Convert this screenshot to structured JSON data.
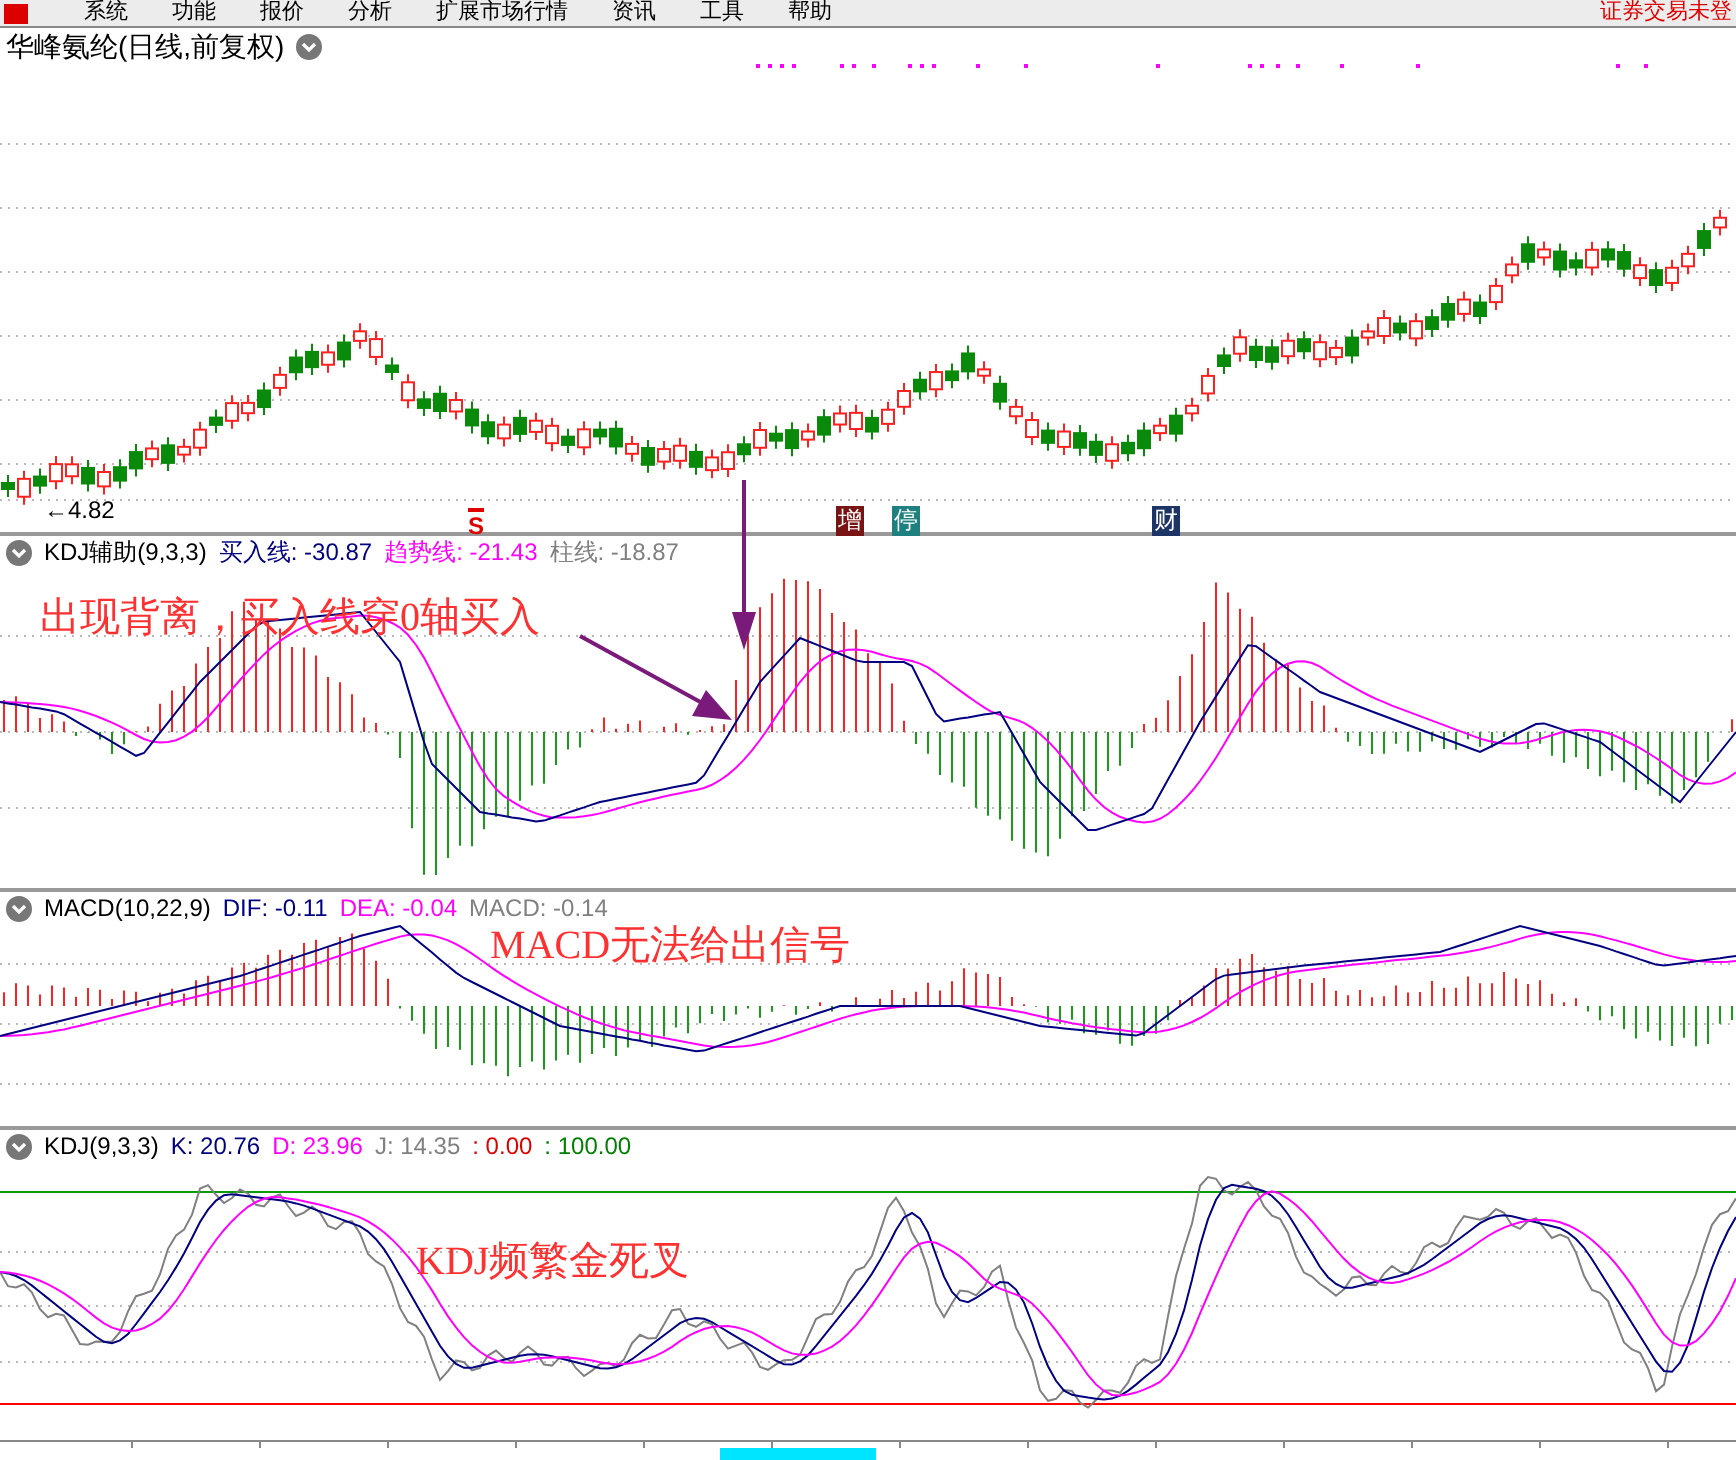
{
  "menu": [
    "系统",
    "功能",
    "报价",
    "分析",
    "扩展市场行情",
    "资讯",
    "工具",
    "帮助"
  ],
  "login_status": "证券交易未登",
  "title": "华峰氨纶(日线,前复权)",
  "price_panel": {
    "low_label": "←4.82",
    "markers": [
      {
        "text": "S",
        "kind": "signal",
        "color": "#e00000"
      },
      {
        "text": "增",
        "kind": "badge",
        "color": "#7a1414"
      },
      {
        "text": "停",
        "kind": "badge",
        "color": "#1f8080"
      },
      {
        "text": "财",
        "kind": "badge",
        "color": "#1c3566"
      }
    ]
  },
  "panels": [
    {
      "name": "KDJ辅助(9,3,3)",
      "values": [
        {
          "text": "买入线: -30.87",
          "color": "#000080"
        },
        {
          "text": "趋势线: -21.43",
          "color": "#ff00ff"
        },
        {
          "text": "柱线: -18.87",
          "color": "#808080"
        }
      ],
      "annotation": "出现背离，买入线穿0轴买入"
    },
    {
      "name": "MACD(10,22,9)",
      "values": [
        {
          "text": "DIF: -0.11",
          "color": "#000080"
        },
        {
          "text": "DEA: -0.04",
          "color": "#ff00ff"
        },
        {
          "text": "MACD: -0.14",
          "color": "#808080"
        }
      ],
      "annotation": "MACD无法给出信号"
    },
    {
      "name": "KDJ(9,3,3)",
      "values": [
        {
          "text": "K: 20.76",
          "color": "#000080"
        },
        {
          "text": "D: 23.96",
          "color": "#ff00ff"
        },
        {
          "text": "J: 14.35",
          "color": "#808080"
        },
        {
          "text": ": 0.00",
          "color": "#e00000"
        },
        {
          "text": ": 100.00",
          "color": "#008000"
        }
      ],
      "annotation": "KDJ频繁金死叉"
    }
  ]
}
